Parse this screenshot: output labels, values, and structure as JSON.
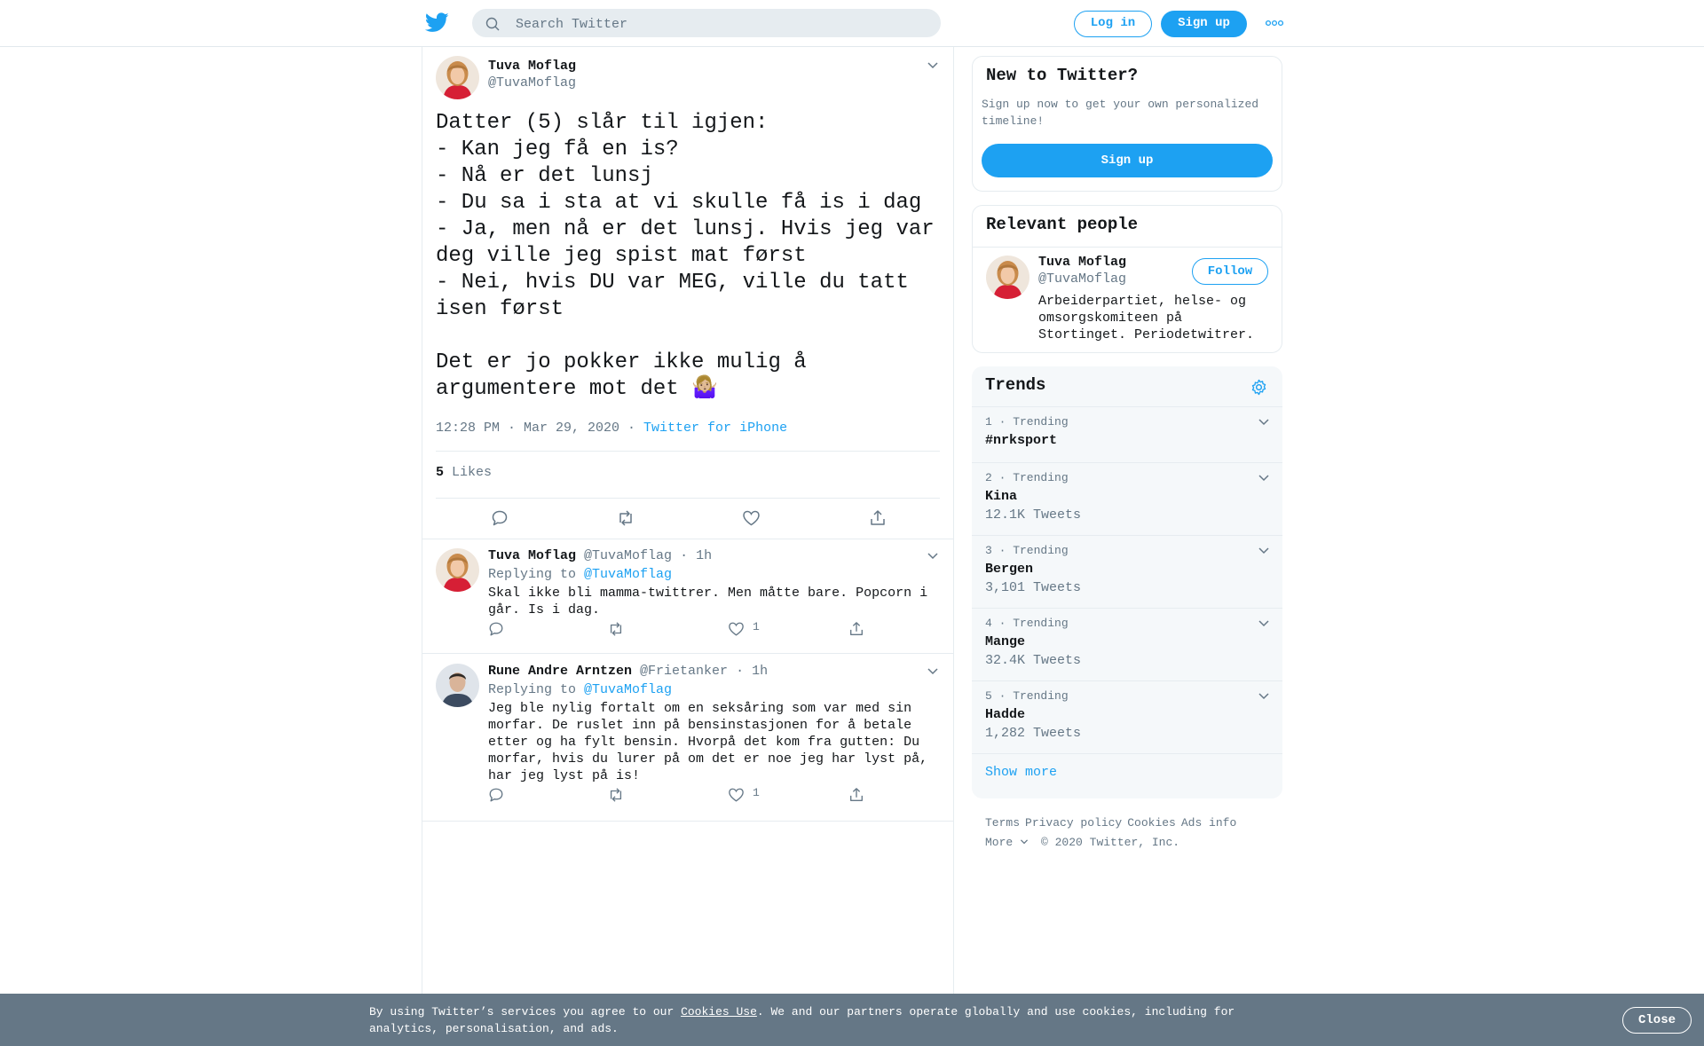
{
  "header": {
    "search_placeholder": "Search Twitter",
    "login_label": "Log in",
    "signup_label": "Sign up",
    "logo_icon": "twitter-bird-icon",
    "more_icon": "more-dots-icon"
  },
  "tweet": {
    "name": "Tuva Moflag",
    "handle": "@TuvaMoflag",
    "text": "Datter (5) slår til igjen:\n- Kan jeg få en is?\n- Nå er det lunsj\n- Du sa i sta at vi skulle få is i dag\n- Ja, men nå er det lunsj. Hvis jeg var deg ville jeg spist mat først\n- Nei, hvis DU var MEG, ville du tatt isen først\n\nDet er jo pokker ikke mulig å argumentere mot det 🤷🏼‍♀️",
    "time": "12:28 PM · Mar 29, 2020 · ",
    "source": "Twitter for iPhone",
    "likes_count": "5",
    "likes_label": "Likes"
  },
  "replies": [
    {
      "name": "Tuva Moflag",
      "handle": "@TuvaMoflag",
      "age": "· 1h",
      "replying_label": "Replying to",
      "replying_to": "@TuvaMoflag",
      "text": "Skal ikke bli mamma-twittrer. Men måtte bare. Popcorn i går. Is i dag.",
      "likes": "1"
    },
    {
      "name": "Rune Andre Arntzen",
      "handle": "@Frietanker",
      "age": "· 1h",
      "replying_label": "Replying to",
      "replying_to": "@TuvaMoflag",
      "text": "Jeg ble nylig fortalt om en seksåring som var med sin morfar. De ruslet inn på bensinstasjonen for å betale etter og ha fylt bensin. Hvorpå det kom fra gutten: Du morfar, hvis du lurer på om det er noe jeg har lyst på, har jeg lyst på is!",
      "likes": "1"
    }
  ],
  "new_to_twitter": {
    "title": "New to Twitter?",
    "description": "Sign up now to get your own personalized timeline!",
    "signup_label": "Sign up"
  },
  "relevant_people": {
    "title": "Relevant people",
    "name": "Tuva Moflag",
    "handle": "@TuvaMoflag",
    "follow_label": "Follow",
    "bio": "Arbeiderpartiet, helse- og omsorgskomiteen på Stortinget. Periodetwitrer."
  },
  "trends": {
    "title": "Trends",
    "items": [
      {
        "rank": "1 · Trending",
        "term": "#nrksport",
        "count": ""
      },
      {
        "rank": "2 · Trending",
        "term": "Kina",
        "count": "12.1K Tweets"
      },
      {
        "rank": "3 · Trending",
        "term": "Bergen",
        "count": "3,101 Tweets"
      },
      {
        "rank": "4 · Trending",
        "term": "Mange",
        "count": "32.4K Tweets"
      },
      {
        "rank": "5 · Trending",
        "term": "Hadde",
        "count": "1,282 Tweets"
      }
    ],
    "show_more": "Show more"
  },
  "footer": {
    "terms": "Terms",
    "privacy": "Privacy policy",
    "cookies": "Cookies",
    "ads": "Ads info",
    "more": "More",
    "copyright": "© 2020 Twitter, Inc."
  },
  "cookie_bar": {
    "text_before": "By using Twitter’s services you agree to our ",
    "link": "Cookies Use",
    "text_after": ". We and our partners operate globally and use cookies, including for analytics, personalisation, and ads.",
    "close_label": "Close"
  },
  "colors": {
    "accent": "#1da1f2",
    "muted": "#657786",
    "cookie_bg": "#657786",
    "trends_bg": "#f5f8fa"
  }
}
